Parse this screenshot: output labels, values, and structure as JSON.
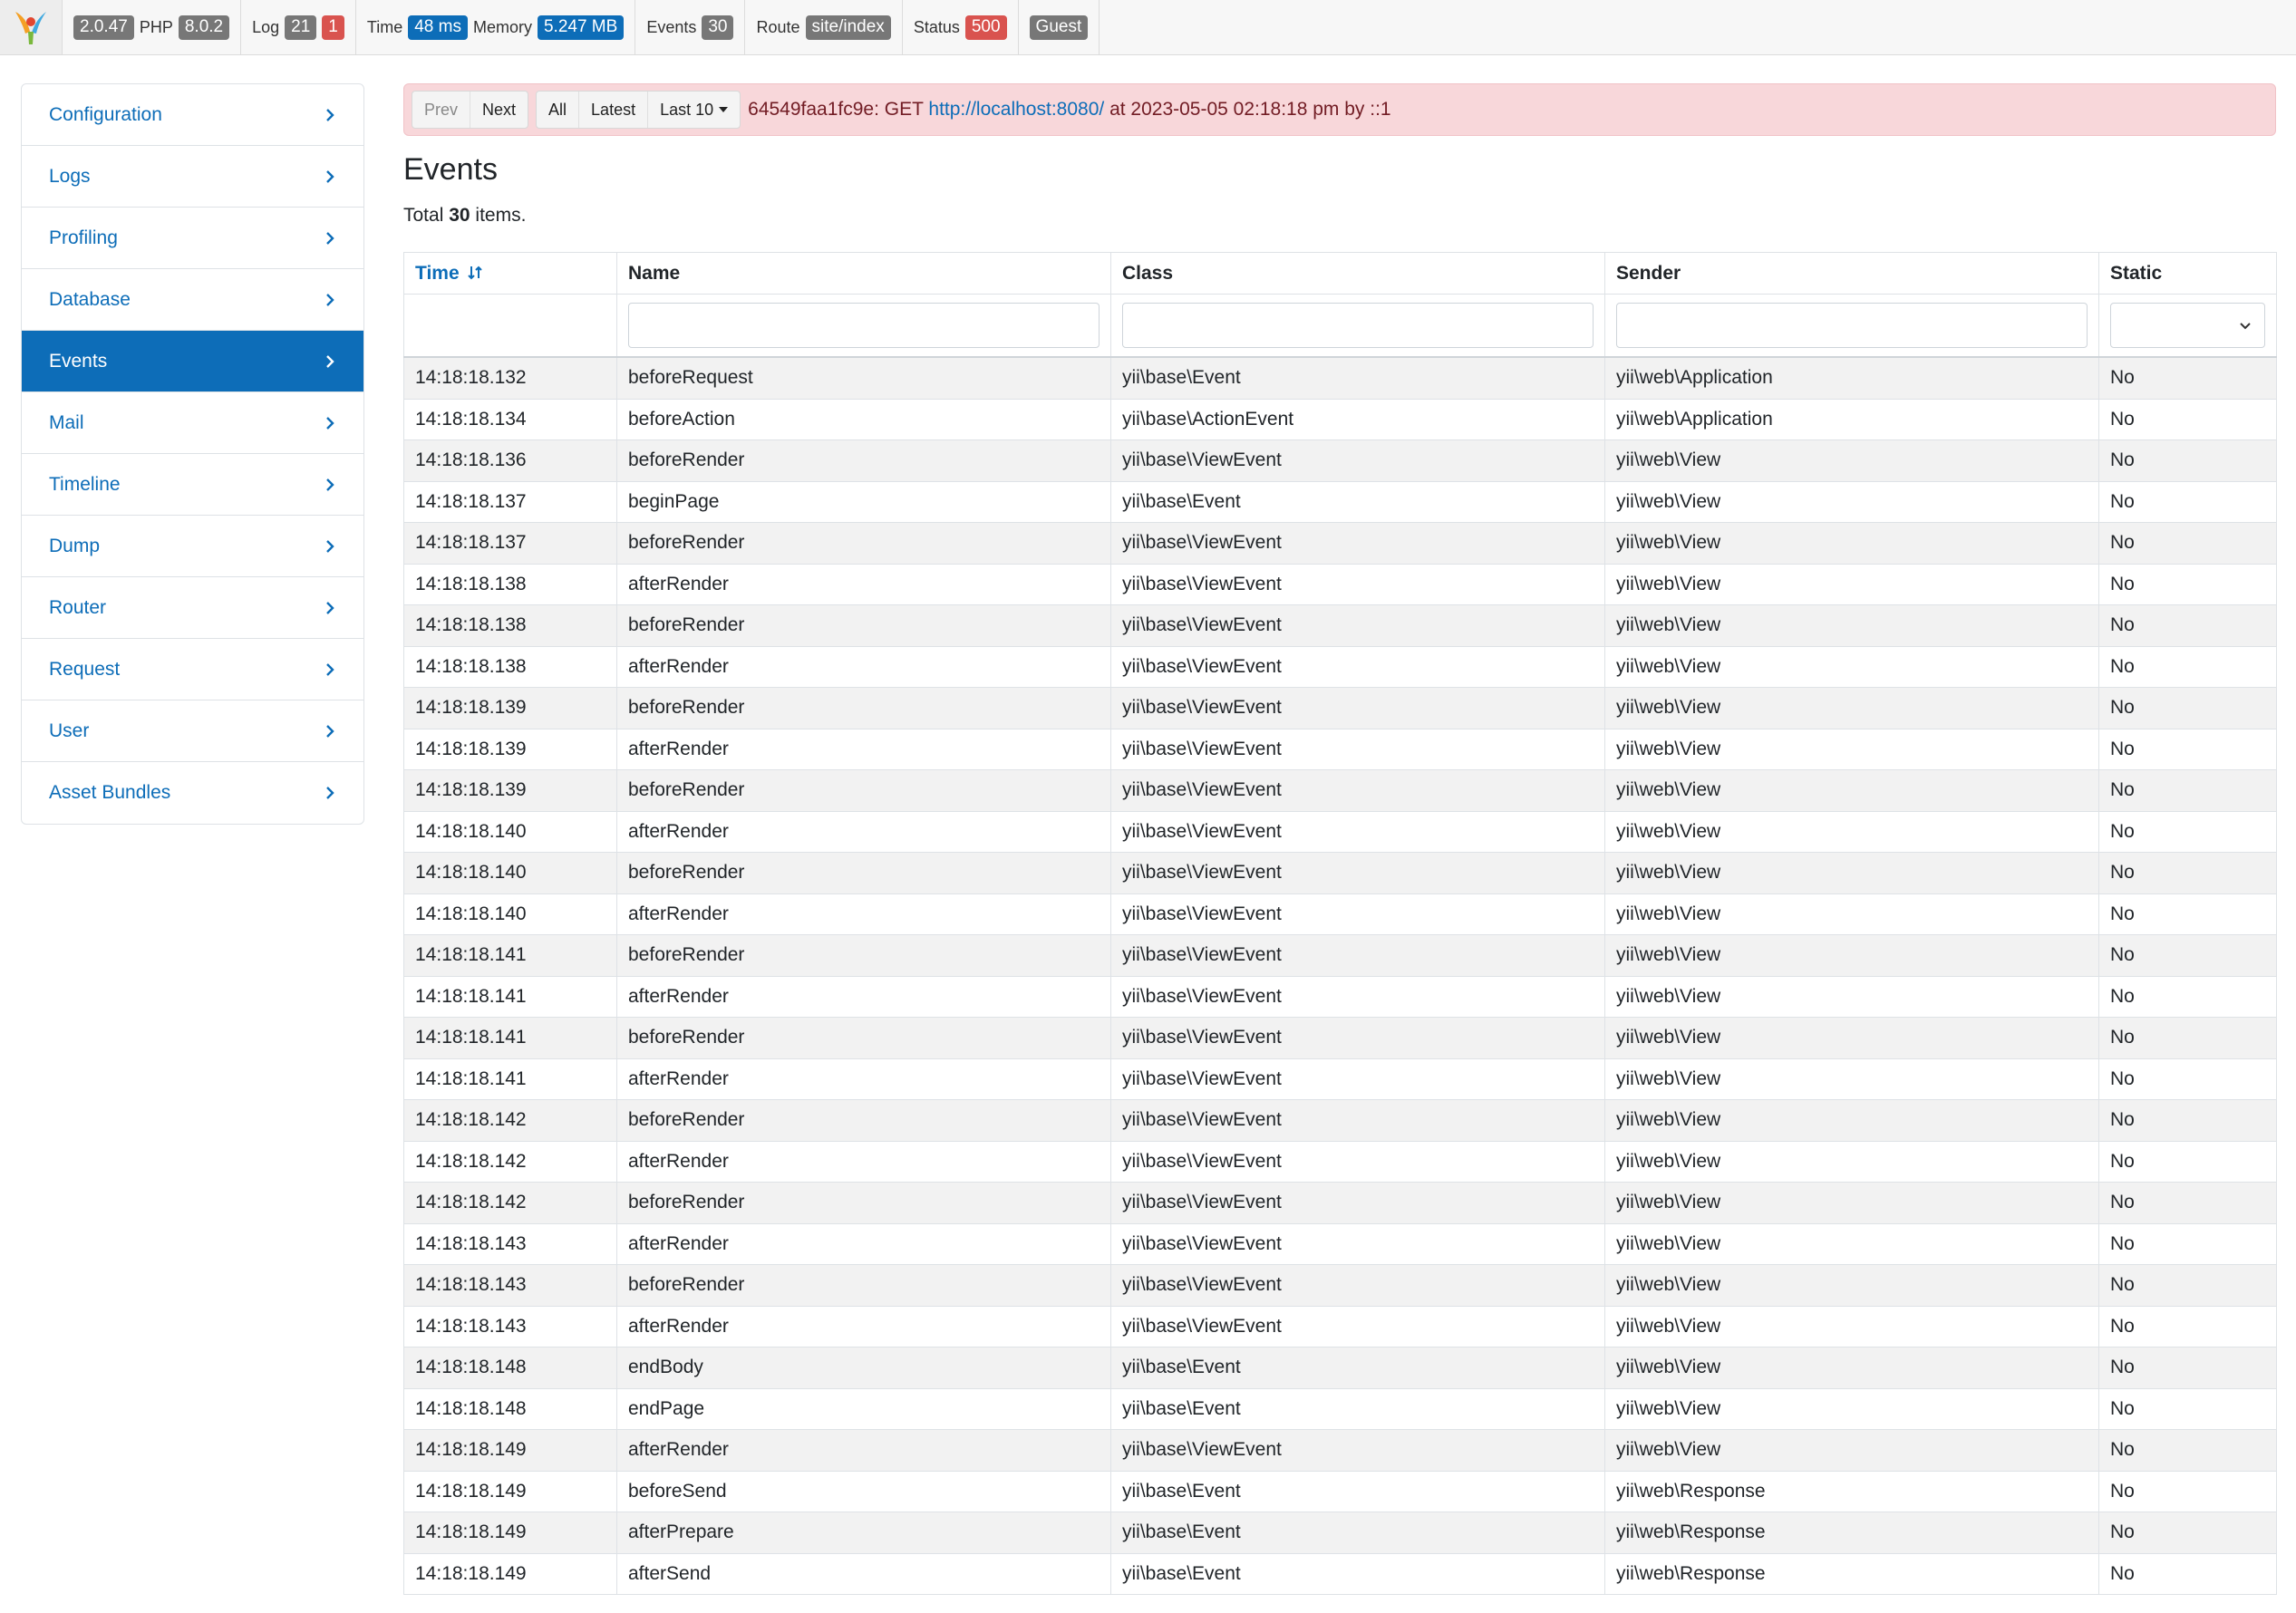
{
  "toolbar": {
    "yii_version": "2.0.47",
    "php_label": "PHP",
    "php_version": "8.0.2",
    "log_label": "Log",
    "log_count": "21",
    "log_errors": "1",
    "time_label": "Time",
    "time_value": "48 ms",
    "memory_label": "Memory",
    "memory_value": "5.247 MB",
    "events_label": "Events",
    "events_count": "30",
    "route_label": "Route",
    "route_value": "site/index",
    "status_label": "Status",
    "status_value": "500",
    "user_value": "Guest"
  },
  "sidebar": {
    "items": [
      {
        "label": "Configuration"
      },
      {
        "label": "Logs"
      },
      {
        "label": "Profiling"
      },
      {
        "label": "Database"
      },
      {
        "label": "Events"
      },
      {
        "label": "Mail"
      },
      {
        "label": "Timeline"
      },
      {
        "label": "Dump"
      },
      {
        "label": "Router"
      },
      {
        "label": "Request"
      },
      {
        "label": "User"
      },
      {
        "label": "Asset Bundles"
      }
    ]
  },
  "nav": {
    "prev": "Prev",
    "next": "Next",
    "all": "All",
    "latest": "Latest",
    "last10": "Last 10"
  },
  "request": {
    "tag": "64549faa1fc9e: GET",
    "url": "http://localhost:8080/",
    "suffix": "at 2023-05-05 02:18:18 pm by ::1"
  },
  "page": {
    "title": "Events",
    "total_prefix": "Total",
    "total_count": "30",
    "total_suffix": "items."
  },
  "table": {
    "columns": [
      "Time",
      "Name",
      "Class",
      "Sender",
      "Static"
    ],
    "rows": [
      [
        "14:18:18.132",
        "beforeRequest",
        "yii\\base\\Event",
        "yii\\web\\Application",
        "No"
      ],
      [
        "14:18:18.134",
        "beforeAction",
        "yii\\base\\ActionEvent",
        "yii\\web\\Application",
        "No"
      ],
      [
        "14:18:18.136",
        "beforeRender",
        "yii\\base\\ViewEvent",
        "yii\\web\\View",
        "No"
      ],
      [
        "14:18:18.137",
        "beginPage",
        "yii\\base\\Event",
        "yii\\web\\View",
        "No"
      ],
      [
        "14:18:18.137",
        "beforeRender",
        "yii\\base\\ViewEvent",
        "yii\\web\\View",
        "No"
      ],
      [
        "14:18:18.138",
        "afterRender",
        "yii\\base\\ViewEvent",
        "yii\\web\\View",
        "No"
      ],
      [
        "14:18:18.138",
        "beforeRender",
        "yii\\base\\ViewEvent",
        "yii\\web\\View",
        "No"
      ],
      [
        "14:18:18.138",
        "afterRender",
        "yii\\base\\ViewEvent",
        "yii\\web\\View",
        "No"
      ],
      [
        "14:18:18.139",
        "beforeRender",
        "yii\\base\\ViewEvent",
        "yii\\web\\View",
        "No"
      ],
      [
        "14:18:18.139",
        "afterRender",
        "yii\\base\\ViewEvent",
        "yii\\web\\View",
        "No"
      ],
      [
        "14:18:18.139",
        "beforeRender",
        "yii\\base\\ViewEvent",
        "yii\\web\\View",
        "No"
      ],
      [
        "14:18:18.140",
        "afterRender",
        "yii\\base\\ViewEvent",
        "yii\\web\\View",
        "No"
      ],
      [
        "14:18:18.140",
        "beforeRender",
        "yii\\base\\ViewEvent",
        "yii\\web\\View",
        "No"
      ],
      [
        "14:18:18.140",
        "afterRender",
        "yii\\base\\ViewEvent",
        "yii\\web\\View",
        "No"
      ],
      [
        "14:18:18.141",
        "beforeRender",
        "yii\\base\\ViewEvent",
        "yii\\web\\View",
        "No"
      ],
      [
        "14:18:18.141",
        "afterRender",
        "yii\\base\\ViewEvent",
        "yii\\web\\View",
        "No"
      ],
      [
        "14:18:18.141",
        "beforeRender",
        "yii\\base\\ViewEvent",
        "yii\\web\\View",
        "No"
      ],
      [
        "14:18:18.141",
        "afterRender",
        "yii\\base\\ViewEvent",
        "yii\\web\\View",
        "No"
      ],
      [
        "14:18:18.142",
        "beforeRender",
        "yii\\base\\ViewEvent",
        "yii\\web\\View",
        "No"
      ],
      [
        "14:18:18.142",
        "afterRender",
        "yii\\base\\ViewEvent",
        "yii\\web\\View",
        "No"
      ],
      [
        "14:18:18.142",
        "beforeRender",
        "yii\\base\\ViewEvent",
        "yii\\web\\View",
        "No"
      ],
      [
        "14:18:18.143",
        "afterRender",
        "yii\\base\\ViewEvent",
        "yii\\web\\View",
        "No"
      ],
      [
        "14:18:18.143",
        "beforeRender",
        "yii\\base\\ViewEvent",
        "yii\\web\\View",
        "No"
      ],
      [
        "14:18:18.143",
        "afterRender",
        "yii\\base\\ViewEvent",
        "yii\\web\\View",
        "No"
      ],
      [
        "14:18:18.148",
        "endBody",
        "yii\\base\\Event",
        "yii\\web\\View",
        "No"
      ],
      [
        "14:18:18.148",
        "endPage",
        "yii\\base\\Event",
        "yii\\web\\View",
        "No"
      ],
      [
        "14:18:18.149",
        "afterRender",
        "yii\\base\\ViewEvent",
        "yii\\web\\View",
        "No"
      ],
      [
        "14:18:18.149",
        "beforeSend",
        "yii\\base\\Event",
        "yii\\web\\Response",
        "No"
      ],
      [
        "14:18:18.149",
        "afterPrepare",
        "yii\\base\\Event",
        "yii\\web\\Response",
        "No"
      ],
      [
        "14:18:18.149",
        "afterSend",
        "yii\\base\\Event",
        "yii\\web\\Response",
        "No"
      ]
    ]
  },
  "colors": {
    "accent": "#0d6db8",
    "alert_bg": "#f8d7da",
    "badge_gray": "#777777",
    "badge_red": "#d9534f"
  }
}
